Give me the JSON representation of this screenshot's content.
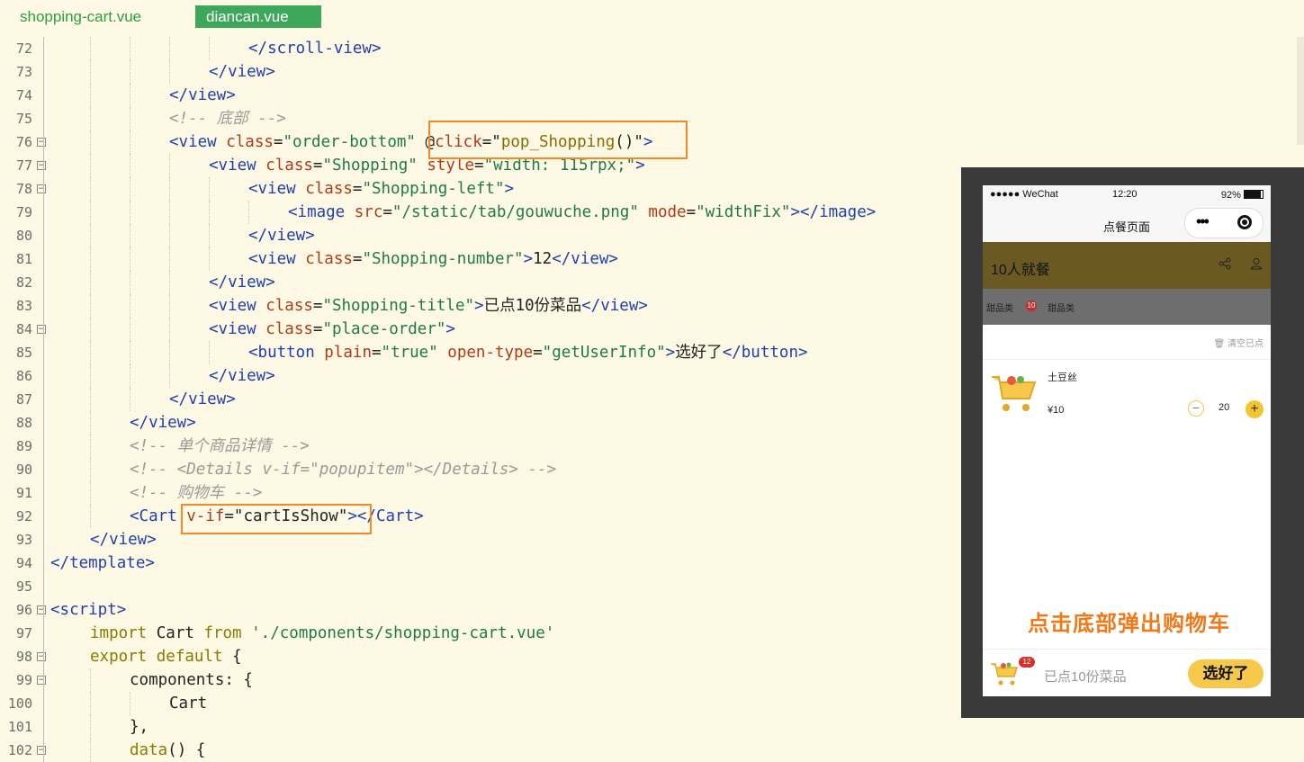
{
  "tabs": [
    {
      "label": "shopping-cart.vue",
      "active": false
    },
    {
      "label": "diancan.vue",
      "active": true
    }
  ],
  "code_lines": [
    {
      "n": "72",
      "indent": 5,
      "fold": false,
      "tokens": [
        [
          "tag",
          "</scroll-view>"
        ]
      ]
    },
    {
      "n": "73",
      "indent": 4,
      "fold": false,
      "tokens": [
        [
          "tag",
          "</view>"
        ]
      ]
    },
    {
      "n": "74",
      "indent": 3,
      "fold": false,
      "tokens": [
        [
          "tag",
          "</view>"
        ]
      ]
    },
    {
      "n": "75",
      "indent": 3,
      "fold": false,
      "tokens": [
        [
          "cmt",
          "<!-- 底部 -->"
        ]
      ]
    },
    {
      "n": "76",
      "indent": 3,
      "fold": true,
      "tokens": [
        [
          "tag",
          "<view "
        ],
        [
          "attr",
          "class"
        ],
        [
          "plain",
          "="
        ],
        [
          "str",
          "\"order-bottom\""
        ],
        [
          "plain",
          " "
        ],
        [
          "plain",
          "@"
        ],
        [
          "attr",
          "click"
        ],
        [
          "plain",
          "="
        ],
        [
          "plain",
          "\""
        ],
        [
          "fn",
          "pop_Shopping"
        ],
        [
          "plain",
          "()\""
        ],
        [
          "tag",
          ">"
        ]
      ]
    },
    {
      "n": "77",
      "indent": 4,
      "fold": true,
      "tokens": [
        [
          "tag",
          "<view "
        ],
        [
          "attr",
          "class"
        ],
        [
          "plain",
          "="
        ],
        [
          "str",
          "\"Shopping\""
        ],
        [
          "plain",
          " "
        ],
        [
          "attr",
          "style"
        ],
        [
          "plain",
          "="
        ],
        [
          "str",
          "\"width: 115rpx;\""
        ],
        [
          "tag",
          ">"
        ]
      ]
    },
    {
      "n": "78",
      "indent": 5,
      "fold": true,
      "tokens": [
        [
          "tag",
          "<view "
        ],
        [
          "attr",
          "class"
        ],
        [
          "plain",
          "="
        ],
        [
          "str",
          "\"Shopping-left\""
        ],
        [
          "tag",
          ">"
        ]
      ]
    },
    {
      "n": "79",
      "indent": 6,
      "fold": false,
      "tokens": [
        [
          "tag",
          "<image "
        ],
        [
          "attr",
          "src"
        ],
        [
          "plain",
          "="
        ],
        [
          "str",
          "\"/static/tab/gouwuche.png\""
        ],
        [
          "plain",
          " "
        ],
        [
          "attr",
          "mode"
        ],
        [
          "plain",
          "="
        ],
        [
          "str",
          "\"widthFix\""
        ],
        [
          "tag",
          "></image>"
        ]
      ]
    },
    {
      "n": "80",
      "indent": 5,
      "fold": false,
      "tokens": [
        [
          "tag",
          "</view>"
        ]
      ]
    },
    {
      "n": "81",
      "indent": 5,
      "fold": false,
      "tokens": [
        [
          "tag",
          "<view "
        ],
        [
          "attr",
          "class"
        ],
        [
          "plain",
          "="
        ],
        [
          "str",
          "\"Shopping-number\""
        ],
        [
          "tag",
          ">"
        ],
        [
          "plain",
          "12"
        ],
        [
          "tag",
          "</view>"
        ]
      ]
    },
    {
      "n": "82",
      "indent": 4,
      "fold": false,
      "tokens": [
        [
          "tag",
          "</view>"
        ]
      ]
    },
    {
      "n": "83",
      "indent": 4,
      "fold": false,
      "tokens": [
        [
          "tag",
          "<view "
        ],
        [
          "attr",
          "class"
        ],
        [
          "plain",
          "="
        ],
        [
          "str",
          "\"Shopping-title\""
        ],
        [
          "tag",
          ">"
        ],
        [
          "plain",
          "已点10份菜品"
        ],
        [
          "tag",
          "</view>"
        ]
      ]
    },
    {
      "n": "84",
      "indent": 4,
      "fold": true,
      "tokens": [
        [
          "tag",
          "<view "
        ],
        [
          "attr",
          "class"
        ],
        [
          "plain",
          "="
        ],
        [
          "str",
          "\"place-order\""
        ],
        [
          "tag",
          ">"
        ]
      ]
    },
    {
      "n": "85",
      "indent": 5,
      "fold": false,
      "tokens": [
        [
          "tag",
          "<button "
        ],
        [
          "attr",
          "plain"
        ],
        [
          "plain",
          "="
        ],
        [
          "str",
          "\"true\""
        ],
        [
          "plain",
          " "
        ],
        [
          "attr",
          "open-type"
        ],
        [
          "plain",
          "="
        ],
        [
          "str",
          "\"getUserInfo\""
        ],
        [
          "tag",
          ">"
        ],
        [
          "plain",
          "选好了"
        ],
        [
          "tag",
          "</button>"
        ]
      ]
    },
    {
      "n": "86",
      "indent": 4,
      "fold": false,
      "tokens": [
        [
          "tag",
          "</view>"
        ]
      ]
    },
    {
      "n": "87",
      "indent": 3,
      "fold": false,
      "tokens": [
        [
          "tag",
          "</view>"
        ]
      ]
    },
    {
      "n": "88",
      "indent": 2,
      "fold": false,
      "tokens": [
        [
          "tag",
          "</view>"
        ]
      ]
    },
    {
      "n": "89",
      "indent": 2,
      "fold": false,
      "tokens": [
        [
          "cmt",
          "<!-- 单个商品详情 -->"
        ]
      ]
    },
    {
      "n": "90",
      "indent": 2,
      "fold": false,
      "tokens": [
        [
          "cmt",
          "<!-- <Details v-if=\"popupitem\"></Details> -->"
        ]
      ]
    },
    {
      "n": "91",
      "indent": 2,
      "fold": false,
      "tokens": [
        [
          "cmt",
          "<!-- 购物车 -->"
        ]
      ]
    },
    {
      "n": "92",
      "indent": 2,
      "fold": false,
      "tokens": [
        [
          "tag",
          "<Cart "
        ],
        [
          "attr",
          "v-if"
        ],
        [
          "plain",
          "="
        ],
        [
          "plain",
          "\"cartIsShow\""
        ],
        [
          "tag",
          "></Cart>"
        ]
      ]
    },
    {
      "n": "93",
      "indent": 1,
      "fold": false,
      "tokens": [
        [
          "tag",
          "</view>"
        ]
      ]
    },
    {
      "n": "94",
      "indent": 0,
      "fold": false,
      "tokens": [
        [
          "tag",
          "</template>"
        ]
      ]
    },
    {
      "n": "95",
      "indent": 0,
      "fold": false,
      "tokens": []
    },
    {
      "n": "96",
      "indent": 0,
      "fold": true,
      "tokens": [
        [
          "tag",
          "<script>"
        ]
      ]
    },
    {
      "n": "97",
      "indent": 1,
      "fold": false,
      "tokens": [
        [
          "kw",
          "import "
        ],
        [
          "plain",
          "Cart "
        ],
        [
          "kw",
          "from "
        ],
        [
          "str",
          "'./components/shopping-cart.vue'"
        ]
      ]
    },
    {
      "n": "98",
      "indent": 1,
      "fold": true,
      "tokens": [
        [
          "kw",
          "export default "
        ],
        [
          "plain",
          "{"
        ]
      ]
    },
    {
      "n": "99",
      "indent": 2,
      "fold": true,
      "tokens": [
        [
          "plain",
          "components: {"
        ]
      ]
    },
    {
      "n": "100",
      "indent": 3,
      "fold": false,
      "tokens": [
        [
          "plain",
          "Cart"
        ]
      ]
    },
    {
      "n": "101",
      "indent": 2,
      "fold": false,
      "tokens": [
        [
          "plain",
          "},"
        ]
      ]
    },
    {
      "n": "102",
      "indent": 2,
      "fold": true,
      "tokens": [
        [
          "kw",
          "data"
        ],
        [
          "plain",
          "() {"
        ]
      ]
    }
  ],
  "phone": {
    "carrier": "●●●●● WeChat",
    "time": "12:20",
    "battery": "92%",
    "nav_title": "点餐页面",
    "capsule_dots": "•••",
    "header_title": "10人就餐",
    "share_icon": "share-icon",
    "user_icon": "user-icon",
    "cat1": "甜品类",
    "cat_badge": "10",
    "cat2": "甜品类",
    "clear_label": "🗑 清空已点",
    "item_name": "土豆丝",
    "item_price": "¥10",
    "minus": "−",
    "qty": "20",
    "plus": "+",
    "caption": "点击底部弹出购物车",
    "cart_badge": "12",
    "bottom_title": "已点10份菜品",
    "order_button": "选好了",
    "colors": {
      "accent": "#f6c94a",
      "caption": "#f07a1a",
      "header": "#6a5a22"
    }
  }
}
